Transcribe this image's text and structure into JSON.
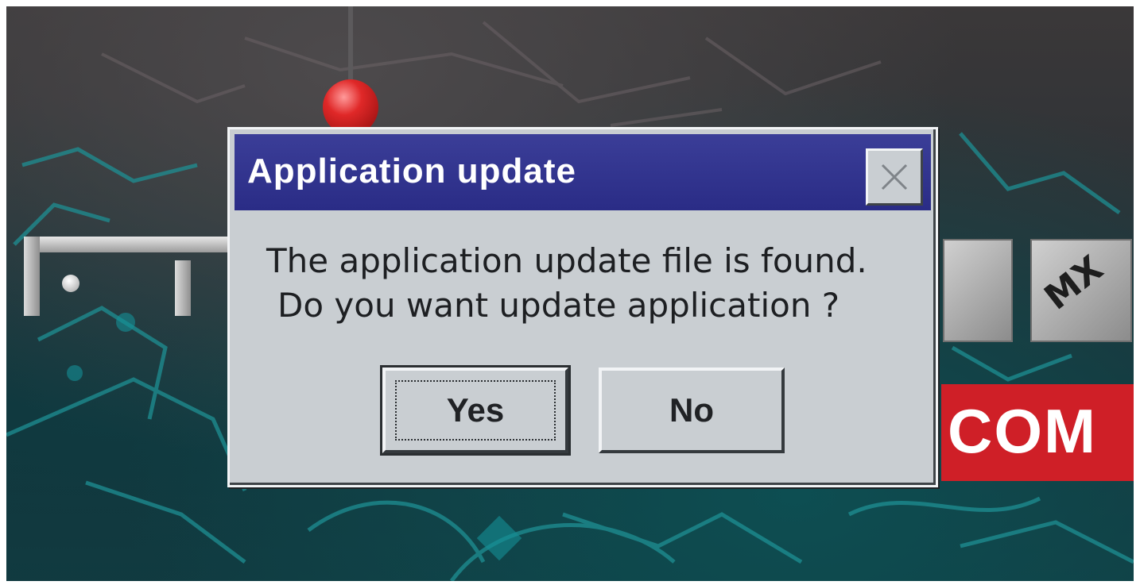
{
  "dialog": {
    "title": "Application update",
    "message_line1": "The application update file is found.",
    "message_line2": "Do you want update application ?",
    "buttons": {
      "yes_label": "Yes",
      "no_label": "No"
    },
    "close_icon": "close-icon"
  },
  "background": {
    "banner_text": "COM",
    "tile_mark": "MX"
  },
  "colors": {
    "titlebar": "#2f3190",
    "dialog_face": "#c9ced2",
    "banner_red": "#cf1f27",
    "map_teal": "#1c8a8e"
  }
}
